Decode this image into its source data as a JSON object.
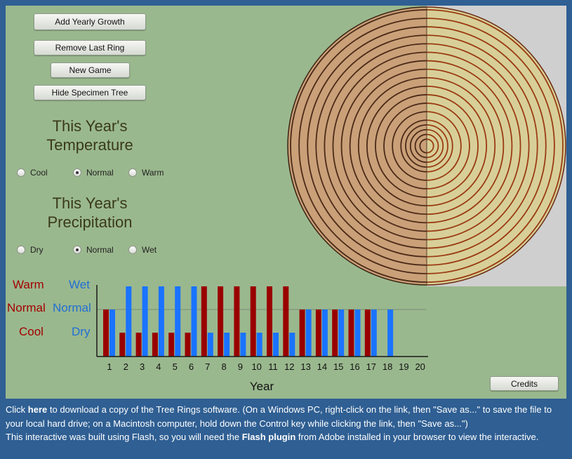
{
  "buttons": {
    "add_yearly_growth": "Add Yearly Growth",
    "remove_last_ring": "Remove Last Ring",
    "new_game": "New Game",
    "hide_specimen_tree": "Hide Specimen Tree",
    "credits": "Credits"
  },
  "temperature": {
    "heading_line1": "This Year's",
    "heading_line2": "Temperature",
    "options": [
      "Cool",
      "Normal",
      "Warm"
    ],
    "selected": "Normal"
  },
  "precipitation": {
    "heading_line1": "This Year's",
    "heading_line2": "Precipitation",
    "options": [
      "Dry",
      "Normal",
      "Wet"
    ],
    "selected": "Normal"
  },
  "colors": {
    "stage_bg": "#9ab88e",
    "page_bg": "#2f5f93",
    "temperature_bar": "#990000",
    "precipitation_bar": "#1a73ff",
    "wood_left": "#caa078",
    "wood_right": "#d8cf98",
    "ring_left": "#4b2a18",
    "ring_right": "#9a3b12",
    "ring_bg": "#cfcfcf"
  },
  "chart_data": {
    "type": "bar",
    "categories": [
      "1",
      "2",
      "3",
      "4",
      "5",
      "6",
      "7",
      "8",
      "9",
      "10",
      "11",
      "12",
      "13",
      "14",
      "15",
      "16",
      "17",
      "18",
      "19",
      "20"
    ],
    "y_levels": {
      "temperature": [
        "Cool",
        "Normal",
        "Warm"
      ],
      "precipitation": [
        "Dry",
        "Normal",
        "Wet"
      ]
    },
    "series": [
      {
        "name": "Temperature",
        "values": [
          1,
          0,
          0,
          0,
          0,
          0,
          2,
          2,
          2,
          2,
          2,
          2,
          1,
          1,
          1,
          1,
          1,
          null,
          null,
          null
        ]
      },
      {
        "name": "Precipitation",
        "values": [
          1,
          2,
          2,
          2,
          2,
          2,
          0,
          0,
          0,
          0,
          0,
          0,
          1,
          1,
          1,
          1,
          1,
          1,
          null,
          null
        ]
      }
    ],
    "left_labels": [
      "Warm",
      "Normal",
      "Cool"
    ],
    "right_labels": [
      "Wet",
      "Normal",
      "Dry"
    ],
    "xlabel": "Year",
    "ylim": [
      0,
      2
    ]
  },
  "tree": {
    "specimen_ring_count": 18,
    "player_ring_count": 18
  },
  "footer": {
    "p1_click": "Click ",
    "p1_here": "here",
    "p1_rest": " to download a copy of the Tree Rings software. (On a Windows PC, right-click on the link, then \"Save as...\" to save the file to your local hard drive; on a Macintosh computer, hold down the Control key while clicking the link, then \"Save as...\")",
    "p2_start": "This interactive was built using Flash, so you will need the ",
    "p2_plugin": "Flash plugin",
    "p2_end": " from Adobe installed in your browser to view the interactive."
  }
}
